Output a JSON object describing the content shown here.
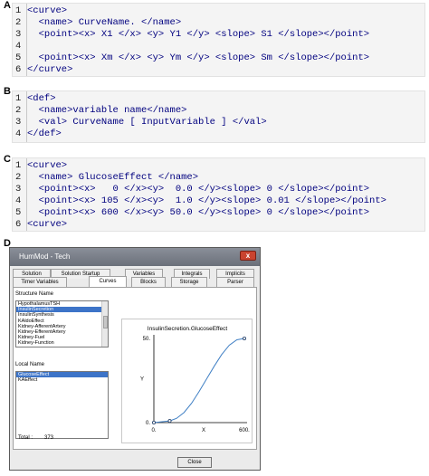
{
  "panels": {
    "a": "A",
    "b": "B",
    "c": "C",
    "d": "D"
  },
  "code_a": [
    {
      "num": "1",
      "text": "<curve>"
    },
    {
      "num": "2",
      "text": "  <name> CurveName. </name>"
    },
    {
      "num": "3",
      "text": "  <point><x> X1 </x> <y> Y1 </y> <slope> S1 </slope></point>"
    },
    {
      "num": "4",
      "text": ""
    },
    {
      "num": "5",
      "text": "  <point><x> Xm </x> <y> Ym </y> <slope> Sm </slope></point>"
    },
    {
      "num": "6",
      "text": "</curve>"
    }
  ],
  "code_b": [
    {
      "num": "1",
      "text": "<def>"
    },
    {
      "num": "2",
      "text": "  <name>variable name</name>"
    },
    {
      "num": "3",
      "text": "  <val> CurveName [ InputVariable ] </val>"
    },
    {
      "num": "4",
      "text": "</def>"
    }
  ],
  "code_c": [
    {
      "num": "1",
      "text": "<curve>"
    },
    {
      "num": "2",
      "text": "  <name> GlucoseEffect </name>"
    },
    {
      "num": "3",
      "text": "  <point><x>   0 </x><y>  0.0 </y><slope> 0 </slope></point>"
    },
    {
      "num": "4",
      "text": "  <point><x> 105 </x><y>  1.0 </y><slope> 0.01 </slope></point>"
    },
    {
      "num": "5",
      "text": "  <point><x> 600 </x><y> 50.0 </y><slope> 0 </slope></point>"
    },
    {
      "num": "6",
      "text": "<curve>"
    }
  ],
  "window": {
    "title": "HumMod - Tech",
    "close_glyph": "x",
    "tabs_row1": [
      "Solution",
      "Solution Startup",
      "Variables",
      "Integrals",
      "Implicits"
    ],
    "tabs_row2": [
      "Timer Variables",
      "Curves",
      "Blocks",
      "Storage",
      "Parser"
    ],
    "structure_label": "Structure Name",
    "structure_items": [
      "HypothalamusTSH",
      "InsulinSecretion",
      "InsulinSynthesis",
      "KAldoEffect",
      "Kidney-AfferentArtery",
      "Kidney-EfferentArtery",
      "Kidney-Fuel",
      "Kidney-Function"
    ],
    "local_label": "Local Name",
    "local_items": [
      "GlucoseEffect",
      "KAEffect"
    ],
    "total_label": "Total :",
    "total_value": "373",
    "close_label": "Close"
  },
  "chart_data": {
    "type": "line",
    "title": "InsulinSecretion.GlucoseEffect",
    "xlabel": "X",
    "ylabel": "Y",
    "x_ticks": [
      "0.",
      "600."
    ],
    "y_ticks": [
      "0.",
      "50."
    ],
    "xlim": [
      0,
      600
    ],
    "ylim": [
      0,
      50
    ],
    "points": [
      {
        "x": 0,
        "y": 0.0
      },
      {
        "x": 105,
        "y": 1.0
      },
      {
        "x": 600,
        "y": 50.0
      }
    ],
    "curve": [
      {
        "x": 105,
        "y": 1.0
      },
      {
        "x": 150,
        "y": 2.5
      },
      {
        "x": 200,
        "y": 6.0
      },
      {
        "x": 250,
        "y": 11.5
      },
      {
        "x": 300,
        "y": 18.5
      },
      {
        "x": 350,
        "y": 26.0
      },
      {
        "x": 400,
        "y": 33.5
      },
      {
        "x": 450,
        "y": 40.5
      },
      {
        "x": 500,
        "y": 46.0
      },
      {
        "x": 550,
        "y": 49.2
      },
      {
        "x": 600,
        "y": 50.0
      }
    ],
    "line_color": "#3f7fc4",
    "point_color": "#1f3c66",
    "grid": false
  },
  "colors": {
    "code_text": "#00007f",
    "code_bg": "#f4f4f4",
    "selection": "#3d74c8"
  }
}
